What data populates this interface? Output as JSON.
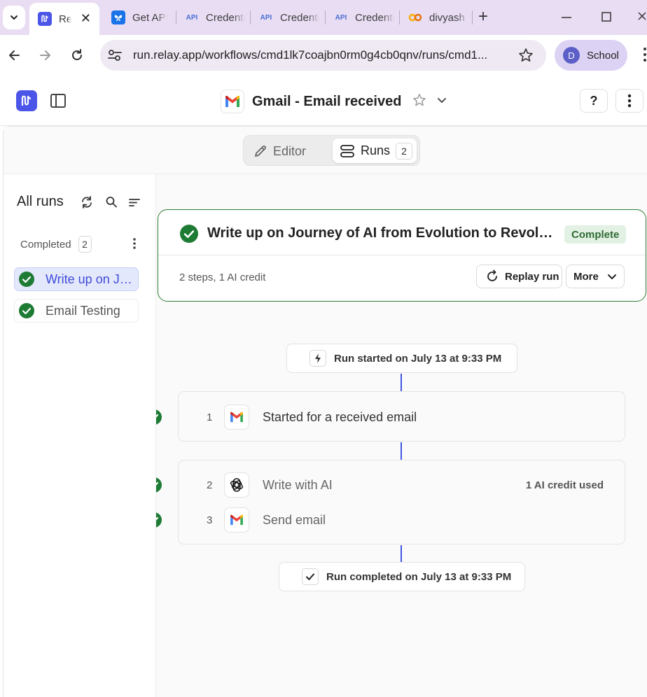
{
  "browser": {
    "tabs": [
      {
        "title": "Relay",
        "favicon": "relay-favicon",
        "active": true
      },
      {
        "title": "Get API",
        "favicon": "butterfly-favicon"
      },
      {
        "title": "Credentials",
        "favicon": "api-favicon",
        "favicon_text": "API"
      },
      {
        "title": "Credentials",
        "favicon": "api-favicon",
        "favicon_text": "API"
      },
      {
        "title": "Credentials",
        "favicon": "api-favicon",
        "favicon_text": "API"
      },
      {
        "title": "divyash",
        "favicon": "colab-favicon"
      }
    ],
    "url": "run.relay.app/workflows/cmd1lk7coajbn0rm0g4cb0qnv/runs/cmd1...",
    "profile": {
      "initial": "D",
      "name": "School"
    }
  },
  "header": {
    "workflow_title": "Gmail - Email received",
    "help_label": "?"
  },
  "mode_toggle": {
    "editor_label": "Editor",
    "runs_label": "Runs",
    "runs_count": "2"
  },
  "sidebar": {
    "title": "All runs",
    "group_label": "Completed",
    "group_count": "2",
    "runs": [
      {
        "label": "Write up on Journey of AI from Evolution to Revolution",
        "selected": true
      },
      {
        "label": "Email Testing",
        "selected": false
      }
    ]
  },
  "run": {
    "title": "Write up on Journey of AI from Evolution to Revolution",
    "status": "Complete",
    "meta": "2 steps, 1 AI credit",
    "replay_label": "Replay run",
    "more_label": "More"
  },
  "timeline": {
    "start_label": "Run started on July 13 at 9:33 PM",
    "end_label": "Run completed on July 13 at 9:33 PM",
    "steps": [
      {
        "num": "1",
        "label": "Started for a received email",
        "icon": "gmail-icon"
      },
      {
        "num": "2",
        "label": "Write with AI",
        "icon": "openai-icon",
        "note": "1 AI credit used"
      },
      {
        "num": "3",
        "label": "Send email",
        "icon": "gmail-icon"
      }
    ]
  },
  "colors": {
    "accent": "#4b55e8",
    "success": "#1e7b34",
    "timeline_line": "#3f57e0",
    "tabbar": "#e9ddf3"
  }
}
